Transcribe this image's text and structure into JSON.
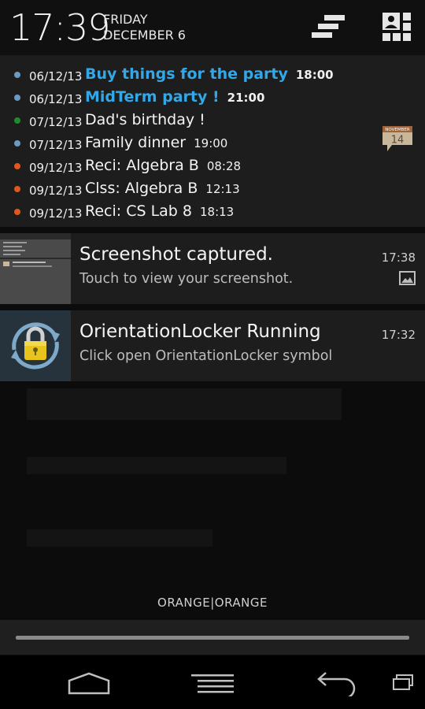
{
  "status": {
    "time": "17:39",
    "day": "FRIDAY",
    "date": "DECEMBER 6",
    "icons": [
      "settings-sliders-icon",
      "quick-settings-grid-icon"
    ]
  },
  "calendar_widget": {
    "icon": {
      "month": "NOVEMBER",
      "day": "14"
    },
    "events": [
      {
        "date": "06/12/13",
        "title": "Buy things for the party",
        "time": "18:00",
        "highlight": true,
        "dot_color": "#6c9ac0"
      },
      {
        "date": "06/12/13",
        "title": "MidTerm party !",
        "time": "21:00",
        "highlight": true,
        "dot_color": "#6c9ac0"
      },
      {
        "date": "07/12/13",
        "title": "Dad's birthday !",
        "time": "",
        "highlight": false,
        "dot_color": "#1f8b2c"
      },
      {
        "date": "07/12/13",
        "title": "Family dinner",
        "time": "19:00",
        "highlight": false,
        "dot_color": "#6c9ac0"
      },
      {
        "date": "09/12/13",
        "title": "Reci: Algebra B",
        "time": "08:28",
        "highlight": false,
        "dot_color": "#e0571e"
      },
      {
        "date": "09/12/13",
        "title": "Clss: Algebra B",
        "time": "12:13",
        "highlight": false,
        "dot_color": "#e0571e"
      },
      {
        "date": "09/12/13",
        "title": "Reci: CS Lab 8",
        "time": "18:13",
        "highlight": false,
        "dot_color": "#e0571e"
      }
    ]
  },
  "notifications": [
    {
      "title": "Screenshot captured.",
      "text": "Touch to view your screenshot.",
      "time": "17:38",
      "icon": "picture-icon"
    },
    {
      "title": "OrientationLocker Running",
      "text": "Click open OrientationLocker symbol",
      "time": "17:32",
      "icon": "padlock-rotate-icon"
    }
  ],
  "footer": {
    "label": "ORANGE|ORANGE"
  },
  "navbar": {
    "icons": [
      "home-icon",
      "menu-icon",
      "back-icon",
      "recent-apps-icon"
    ]
  }
}
